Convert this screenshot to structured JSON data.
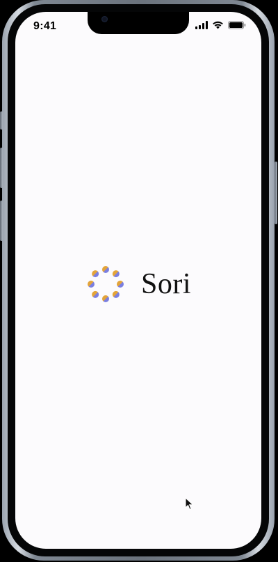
{
  "status_bar": {
    "time": "9:41",
    "icons": [
      "cellular-signal-icon",
      "wifi-icon",
      "battery-icon"
    ]
  },
  "splash": {
    "app_name": "Sori",
    "logo_icon": "dotted-ring-logo-icon"
  },
  "colors": {
    "screen_background": "#fcfbfd",
    "logo_orange": "#e3a43a",
    "logo_blue": "#7b7fe0",
    "text": "#111111"
  }
}
